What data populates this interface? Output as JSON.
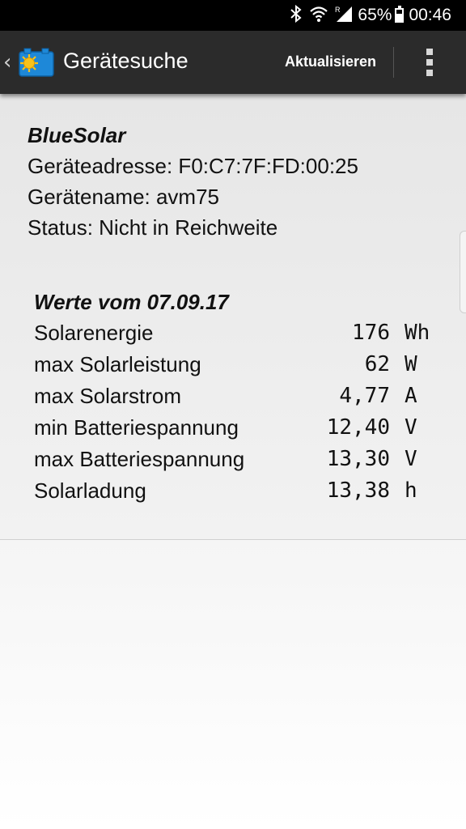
{
  "status_bar": {
    "battery_percent": "65%",
    "time": "00:46",
    "battery_level": 0.65
  },
  "app_bar": {
    "title": "Gerätesuche",
    "refresh_label": "Aktualisieren"
  },
  "device": {
    "name": "BlueSolar",
    "address": "Geräteadresse: F0:C7:7F:FD:00:25",
    "device_name": "Gerätename: avm75",
    "status": "Status: Nicht in Reichweite"
  },
  "values": {
    "heading": "Werte vom 07.09.17",
    "rows": [
      {
        "label": "Solarenergie",
        "value": "176",
        "unit": "Wh"
      },
      {
        "label": "max Solarleistung",
        "value": "62",
        "unit": "W"
      },
      {
        "label": "max Solarstrom",
        "value": "4,77",
        "unit": "A"
      },
      {
        "label": "min Batteriespannung",
        "value": "12,40",
        "unit": "V"
      },
      {
        "label": "max Batteriespannung",
        "value": "13,30",
        "unit": "V"
      },
      {
        "label": "Solarladung",
        "value": "13,38",
        "unit": "h"
      }
    ]
  },
  "icons": {
    "bluetooth": "bluetooth-icon",
    "wifi": "wifi-icon",
    "signal": "signal-icon",
    "battery": "battery-icon",
    "back": "chevron-left-icon",
    "logo": "bluesolar-logo",
    "overflow": "more-vertical-icon"
  },
  "colors": {
    "status_bar": "#000000",
    "app_bar": "#2b2b2b",
    "logo_blue": "#1e88d8",
    "sun": "#f7c21a"
  }
}
